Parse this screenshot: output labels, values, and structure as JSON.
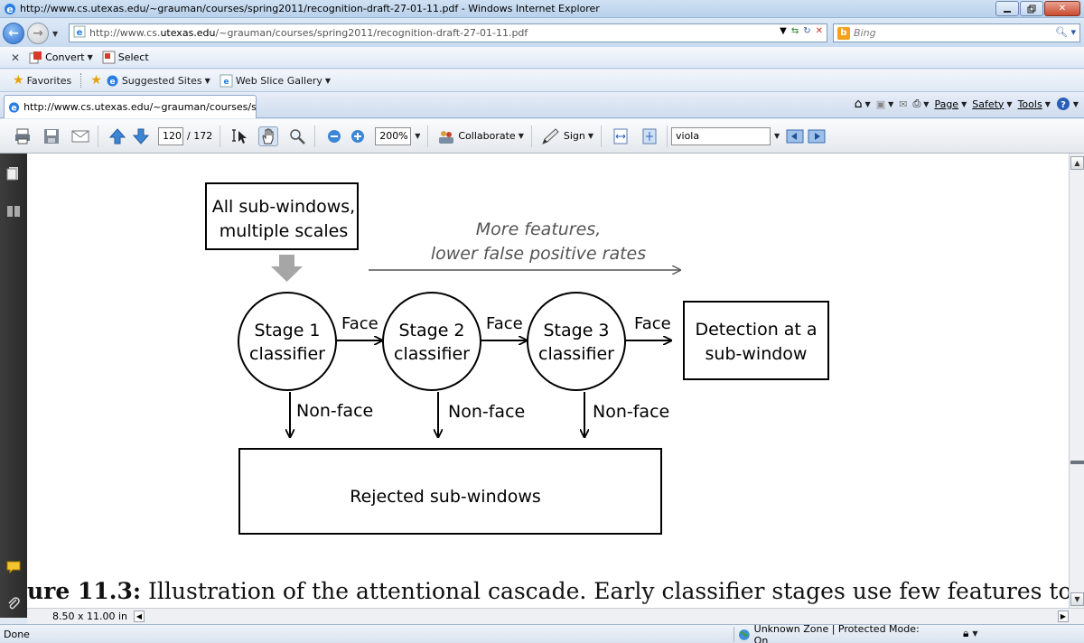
{
  "window": {
    "title": "http://www.cs.utexas.edu/~grauman/courses/spring2011/recognition-draft-27-01-11.pdf - Windows Internet Explorer"
  },
  "address": {
    "url_prefix": "http://www.cs.",
    "url_domain": "utexas.edu",
    "url_path": "/~grauman/courses/spring2011/recognition-draft-27-01-11.pdf",
    "search_placeholder": "Bing"
  },
  "convert_toolbar": {
    "convert_label": "Convert",
    "select_label": "Select"
  },
  "favorites_bar": {
    "favorites_label": "Favorites",
    "suggested_sites_label": "Suggested Sites",
    "web_slice_label": "Web Slice Gallery"
  },
  "tab": {
    "label": "http://www.cs.utexas.edu/~grauman/courses/sp..."
  },
  "command_bar": {
    "page_label": "Page",
    "safety_label": "Safety",
    "tools_label": "Tools"
  },
  "pdf_toolbar": {
    "page_number": "120",
    "page_total": "/ 172",
    "zoom": "200%",
    "collaborate_label": "Collaborate",
    "sign_label": "Sign",
    "find_value": "viola"
  },
  "diagram": {
    "input_box": [
      "All sub-windows,",
      "multiple scales"
    ],
    "annotation": [
      "More features,",
      "lower false positive rates"
    ],
    "stages": [
      {
        "line1": "Stage 1",
        "line2": "classifier"
      },
      {
        "line1": "Stage 2",
        "line2": "classifier"
      },
      {
        "line1": "Stage 3",
        "line2": "classifier"
      }
    ],
    "face_label": "Face",
    "nonface_label": "Non-face",
    "detection_box": [
      "Detection at a",
      "sub-window"
    ],
    "rejected_box": "Rejected sub-windows"
  },
  "caption": {
    "prefix": "ure 11.3:",
    "text": " Illustration of the attentional cascade. Early classifier stages use few features to"
  },
  "page_size": "8.50 x 11.00 in",
  "status": {
    "left_text": "Done",
    "zone_text": "Unknown Zone | Protected Mode: On"
  }
}
